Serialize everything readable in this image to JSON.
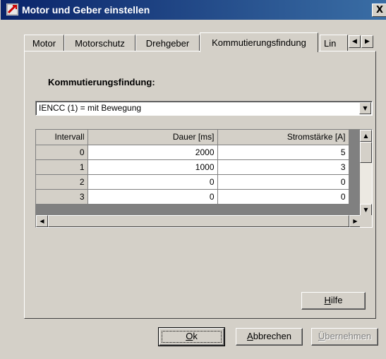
{
  "window": {
    "title": "Motor und Geber einstellen",
    "close_glyph": "X"
  },
  "tabs": [
    {
      "label": "Motor",
      "active": false
    },
    {
      "label": "Motorschutz",
      "active": false
    },
    {
      "label": "Drehgeber",
      "active": false
    },
    {
      "label": "Kommutierungsfindung",
      "active": true
    },
    {
      "label": "Lin",
      "active": false
    }
  ],
  "tab_scroll": {
    "left_icon": "arrow-left-icon",
    "right_icon": "arrow-right-icon"
  },
  "section": {
    "label": "Kommutierungsfindung:",
    "mode_value": "IENCC (1) = mit Bewegung"
  },
  "table": {
    "headers": [
      "Intervall",
      "Dauer [ms]",
      "Stromstärke [A]"
    ],
    "rows": [
      {
        "interval": "0",
        "duration": "2000",
        "current": "5"
      },
      {
        "interval": "1",
        "duration": "1000",
        "current": "3"
      },
      {
        "interval": "2",
        "duration": "0",
        "current": "0"
      },
      {
        "interval": "3",
        "duration": "0",
        "current": "0"
      }
    ]
  },
  "buttons": {
    "help": {
      "prefix": "",
      "mnemonic": "H",
      "suffix": "ilfe"
    },
    "ok": {
      "prefix": "",
      "mnemonic": "O",
      "suffix": "k"
    },
    "cancel": {
      "prefix": "",
      "mnemonic": "A",
      "suffix": "bbrechen"
    },
    "apply": {
      "prefix": "",
      "mnemonic": "Ü",
      "suffix": "bernehmen",
      "disabled": true
    }
  },
  "colors": {
    "titlebar_start": "#0a246a",
    "titlebar_end": "#3a6ea5",
    "face": "#d4d0c8"
  }
}
